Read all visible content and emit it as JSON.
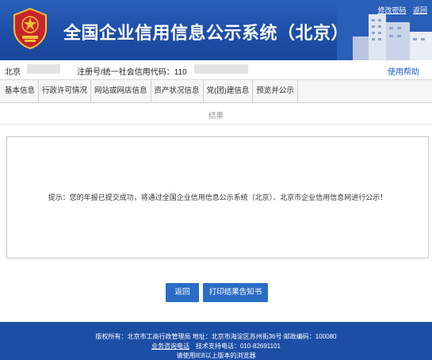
{
  "header": {
    "title": "全国企业信用信息公示系统（北京）",
    "links": [
      "修改密码",
      "返回"
    ]
  },
  "info": {
    "location": "北京",
    "code_label": "注册号/统一社会信用代码：110",
    "help": "使用帮助"
  },
  "tabs": [
    "基本信息",
    "行政许可情况",
    "网站或网店信息",
    "资产状况信息",
    "党(团)建信息",
    "预览并公示"
  ],
  "section_title": "结果",
  "message": "提示：您的年报已提交成功，将通过全国企业信用信息公示系统（北京）、北京市企业信用信息网进行公示！",
  "buttons": {
    "back": "返回",
    "print": "打印结果告知书"
  },
  "footer": {
    "line1": "版权所有：北京市工商行政管理局    地址：北京市海淀区苏州街36号    邮政编码：100080",
    "consult_link": "业务咨询电话",
    "tech_support": "技术支持电话：010-82691101",
    "line3": "请使用IE8以上版本的浏览器"
  },
  "colors": {
    "header_blue": "#1d4ea6",
    "button_blue": "#2b6cc4",
    "link_blue": "#1f5fbf"
  }
}
